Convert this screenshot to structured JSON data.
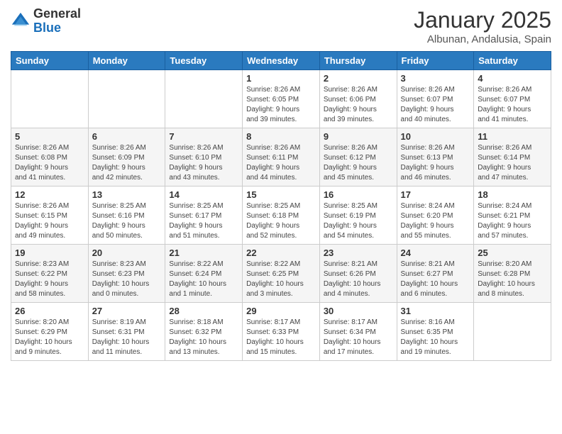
{
  "header": {
    "logo": {
      "general": "General",
      "blue": "Blue"
    },
    "title": "January 2025",
    "location": "Albunan, Andalusia, Spain"
  },
  "weekdays": [
    "Sunday",
    "Monday",
    "Tuesday",
    "Wednesday",
    "Thursday",
    "Friday",
    "Saturday"
  ],
  "weeks": [
    [
      {
        "day": "",
        "info": ""
      },
      {
        "day": "",
        "info": ""
      },
      {
        "day": "",
        "info": ""
      },
      {
        "day": "1",
        "info": "Sunrise: 8:26 AM\nSunset: 6:05 PM\nDaylight: 9 hours\nand 39 minutes."
      },
      {
        "day": "2",
        "info": "Sunrise: 8:26 AM\nSunset: 6:06 PM\nDaylight: 9 hours\nand 39 minutes."
      },
      {
        "day": "3",
        "info": "Sunrise: 8:26 AM\nSunset: 6:07 PM\nDaylight: 9 hours\nand 40 minutes."
      },
      {
        "day": "4",
        "info": "Sunrise: 8:26 AM\nSunset: 6:07 PM\nDaylight: 9 hours\nand 41 minutes."
      }
    ],
    [
      {
        "day": "5",
        "info": "Sunrise: 8:26 AM\nSunset: 6:08 PM\nDaylight: 9 hours\nand 41 minutes."
      },
      {
        "day": "6",
        "info": "Sunrise: 8:26 AM\nSunset: 6:09 PM\nDaylight: 9 hours\nand 42 minutes."
      },
      {
        "day": "7",
        "info": "Sunrise: 8:26 AM\nSunset: 6:10 PM\nDaylight: 9 hours\nand 43 minutes."
      },
      {
        "day": "8",
        "info": "Sunrise: 8:26 AM\nSunset: 6:11 PM\nDaylight: 9 hours\nand 44 minutes."
      },
      {
        "day": "9",
        "info": "Sunrise: 8:26 AM\nSunset: 6:12 PM\nDaylight: 9 hours\nand 45 minutes."
      },
      {
        "day": "10",
        "info": "Sunrise: 8:26 AM\nSunset: 6:13 PM\nDaylight: 9 hours\nand 46 minutes."
      },
      {
        "day": "11",
        "info": "Sunrise: 8:26 AM\nSunset: 6:14 PM\nDaylight: 9 hours\nand 47 minutes."
      }
    ],
    [
      {
        "day": "12",
        "info": "Sunrise: 8:26 AM\nSunset: 6:15 PM\nDaylight: 9 hours\nand 49 minutes."
      },
      {
        "day": "13",
        "info": "Sunrise: 8:25 AM\nSunset: 6:16 PM\nDaylight: 9 hours\nand 50 minutes."
      },
      {
        "day": "14",
        "info": "Sunrise: 8:25 AM\nSunset: 6:17 PM\nDaylight: 9 hours\nand 51 minutes."
      },
      {
        "day": "15",
        "info": "Sunrise: 8:25 AM\nSunset: 6:18 PM\nDaylight: 9 hours\nand 52 minutes."
      },
      {
        "day": "16",
        "info": "Sunrise: 8:25 AM\nSunset: 6:19 PM\nDaylight: 9 hours\nand 54 minutes."
      },
      {
        "day": "17",
        "info": "Sunrise: 8:24 AM\nSunset: 6:20 PM\nDaylight: 9 hours\nand 55 minutes."
      },
      {
        "day": "18",
        "info": "Sunrise: 8:24 AM\nSunset: 6:21 PM\nDaylight: 9 hours\nand 57 minutes."
      }
    ],
    [
      {
        "day": "19",
        "info": "Sunrise: 8:23 AM\nSunset: 6:22 PM\nDaylight: 9 hours\nand 58 minutes."
      },
      {
        "day": "20",
        "info": "Sunrise: 8:23 AM\nSunset: 6:23 PM\nDaylight: 10 hours\nand 0 minutes."
      },
      {
        "day": "21",
        "info": "Sunrise: 8:22 AM\nSunset: 6:24 PM\nDaylight: 10 hours\nand 1 minute."
      },
      {
        "day": "22",
        "info": "Sunrise: 8:22 AM\nSunset: 6:25 PM\nDaylight: 10 hours\nand 3 minutes."
      },
      {
        "day": "23",
        "info": "Sunrise: 8:21 AM\nSunset: 6:26 PM\nDaylight: 10 hours\nand 4 minutes."
      },
      {
        "day": "24",
        "info": "Sunrise: 8:21 AM\nSunset: 6:27 PM\nDaylight: 10 hours\nand 6 minutes."
      },
      {
        "day": "25",
        "info": "Sunrise: 8:20 AM\nSunset: 6:28 PM\nDaylight: 10 hours\nand 8 minutes."
      }
    ],
    [
      {
        "day": "26",
        "info": "Sunrise: 8:20 AM\nSunset: 6:29 PM\nDaylight: 10 hours\nand 9 minutes."
      },
      {
        "day": "27",
        "info": "Sunrise: 8:19 AM\nSunset: 6:31 PM\nDaylight: 10 hours\nand 11 minutes."
      },
      {
        "day": "28",
        "info": "Sunrise: 8:18 AM\nSunset: 6:32 PM\nDaylight: 10 hours\nand 13 minutes."
      },
      {
        "day": "29",
        "info": "Sunrise: 8:17 AM\nSunset: 6:33 PM\nDaylight: 10 hours\nand 15 minutes."
      },
      {
        "day": "30",
        "info": "Sunrise: 8:17 AM\nSunset: 6:34 PM\nDaylight: 10 hours\nand 17 minutes."
      },
      {
        "day": "31",
        "info": "Sunrise: 8:16 AM\nSunset: 6:35 PM\nDaylight: 10 hours\nand 19 minutes."
      },
      {
        "day": "",
        "info": ""
      }
    ]
  ]
}
